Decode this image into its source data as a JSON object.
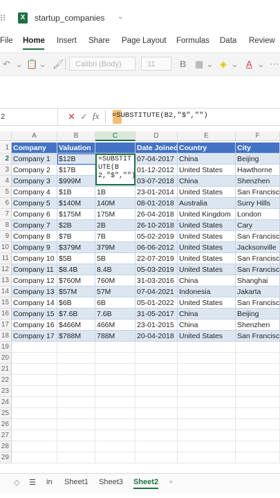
{
  "titlebar": {
    "app_icon_label": "X",
    "doc_title": "startup_companies"
  },
  "menu": [
    "File",
    "Home",
    "Insert",
    "Share",
    "Page Layout",
    "Formulas",
    "Data",
    "Review"
  ],
  "toolbar": {
    "font_name": "Calibri (Body)",
    "font_size": "11",
    "bold": "B"
  },
  "formula_bar": {
    "name_box": "2",
    "fx": "fx",
    "formula": "=SUBSTITUTE(B2,\"$\",\"\")"
  },
  "columns": [
    "A",
    "B",
    "C",
    "D",
    "E",
    "F"
  ],
  "header_row": [
    "Company",
    "Valuation",
    "",
    "Date Joined",
    "Country",
    "City"
  ],
  "rows": [
    [
      "Company 1",
      "$12B",
      "",
      "07-04-2017",
      "China",
      "Beijing"
    ],
    [
      "Company 2",
      "$17B",
      "",
      "01-12-2012",
      "United States",
      "Hawthorne"
    ],
    [
      "Company 3",
      "$999M",
      "",
      "03-07-2018",
      "China",
      "Shenzhen"
    ],
    [
      "Company 4",
      "$1B",
      "1B",
      "23-01-2014",
      "United States",
      "San Francisco"
    ],
    [
      "Company 5",
      "$140M",
      "140M",
      "08-01-2018",
      "Australia",
      "Surry Hills"
    ],
    [
      "Company 6",
      "$175M",
      "175M",
      "26-04-2018",
      "United Kingdom",
      "London"
    ],
    [
      "Company 7",
      "$2B",
      "2B",
      "26-10-2018",
      "United States",
      "Cary"
    ],
    [
      "Company 8",
      "$7B",
      "7B",
      "05-02-2019",
      "United States",
      "San Francisco"
    ],
    [
      "Company 9",
      "$379M",
      "379M",
      "06-06-2012",
      "United States",
      "Jacksonville"
    ],
    [
      "Company 10",
      "$5B",
      "5B",
      "22-07-2019",
      "United States",
      "San Francisco"
    ],
    [
      "Company 11",
      "$8.4B",
      "8.4B",
      "05-03-2019",
      "United States",
      "San Francisco"
    ],
    [
      "Company 12",
      "$760M",
      "760M",
      "31-03-2016",
      "China",
      "Shanghai"
    ],
    [
      "Company 13",
      "$57M",
      "57M",
      "07-04-2021",
      "Indonesia",
      "Jakarta"
    ],
    [
      "Company 14",
      "$6B",
      "6B",
      "05-01-2022",
      "United States",
      "San Francisco"
    ],
    [
      "Company 15",
      "$7.6B",
      "7.6B",
      "31-05-2017",
      "China",
      "Beijing"
    ],
    [
      "Company 16",
      "$466M",
      "466M",
      "23-01-2015",
      "China",
      "Shenzhen"
    ],
    [
      "Company 17",
      "$788M",
      "788M",
      "20-04-2018",
      "United States",
      "San Francisco"
    ]
  ],
  "row_numbers": [
    "1",
    "2",
    "3",
    "4",
    "5",
    "6",
    "7",
    "8",
    "9",
    "10",
    "11",
    "12",
    "13",
    "14",
    "15",
    "16",
    "17",
    "18",
    "19",
    "20",
    "21",
    "22",
    "23",
    "24",
    "25",
    "26",
    "27",
    "28",
    "29"
  ],
  "edit_cell_text": "=SUBSTITUTE(B2,\"$\",\"\")",
  "tabs": {
    "items": [
      "Sheet1",
      "Sheet3",
      "Sheet2"
    ],
    "active": "Sheet2",
    "in_label": "in",
    "add": "+"
  }
}
